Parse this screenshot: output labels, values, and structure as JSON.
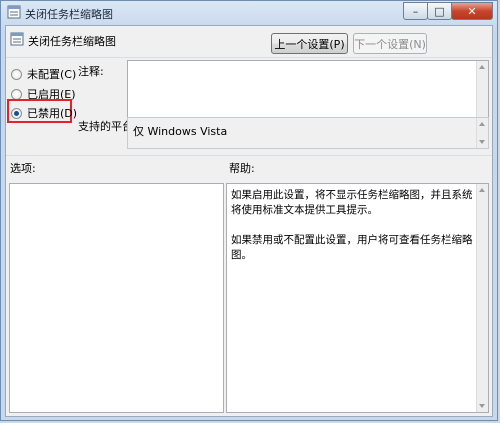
{
  "window": {
    "title": "关闭任务栏缩略图",
    "controls": {
      "minimize": "–",
      "maximize": "□",
      "close": "✕"
    }
  },
  "policy": {
    "title": "关闭任务栏缩略图",
    "prev_button": "上一个设置(P)",
    "next_button": "下一个设置(N)"
  },
  "options": [
    {
      "label": "未配置(C)",
      "checked": false
    },
    {
      "label": "已启用(E)",
      "checked": false
    },
    {
      "label": "已禁用(D)",
      "checked": true
    }
  ],
  "comment": {
    "label": "注释:",
    "value": ""
  },
  "platform": {
    "label": "支持的平台:",
    "value": "仅 Windows Vista"
  },
  "options_section": {
    "label": "选项:"
  },
  "help_section": {
    "label": "帮助:",
    "paragraphs": [
      "如果启用此设置，将不显示任务栏缩略图，并且系统将使用标准文本提供工具提示。",
      "如果禁用或不配置此设置，用户将可查看任务栏缩略图。"
    ]
  },
  "colors": {
    "highlight": "#e0242a",
    "radio_selected": "#1c4f8a"
  }
}
